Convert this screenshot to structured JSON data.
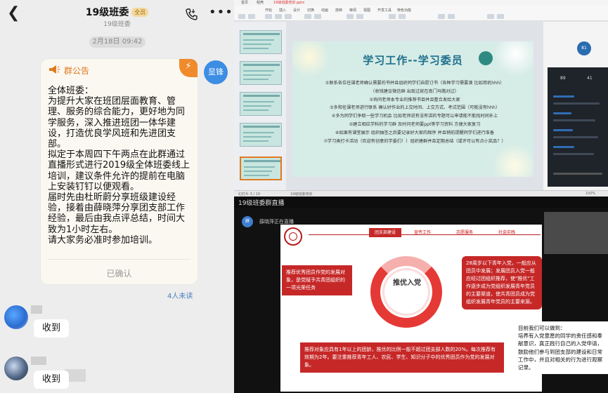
{
  "chat": {
    "header": {
      "title": "19级班委",
      "badge": "全员",
      "subtitle": "19级班委"
    },
    "date_divider": "2月18日 09:42",
    "notice": {
      "label": "群公告",
      "body": "全体班委：\n为提升大家在班团层面教育、管理、服务的综合能力，更好地为同学服务，深入推进班团一体华建设，打造优良学风班和先进团支部。\n拟定于本周四下午两点在此群通过直播形式进行2019级全体班委线上培训，建议条件允许的提前在电脑上安装钉钉以便观看。\n届时先由杜昕蔚分享班级建设经验，接着由薛晓萍分享团支部工作经验，最后由我点评总结，时间大致为1小时左右。\n请大家务必准时参加培训。",
      "confirmed": "已确认",
      "sender_name": "显锋"
    },
    "unread": "4人未读",
    "messages": [
      {
        "text": "收到"
      },
      {
        "text": "收到"
      }
    ]
  },
  "ppt": {
    "tabs": [
      "首页",
      "稻壳",
      "19级班委培训.pptx"
    ],
    "ribbon_tabs": [
      "开始",
      "插入",
      "设计",
      "切换",
      "动画",
      "放映",
      "审阅",
      "视图",
      "开发工具",
      "特色功能"
    ],
    "slide": {
      "title": "学习工作--学习委员",
      "lines": [
        "①联系各位任课老师确认需要的书并且组织同学们自愿订书（各种学习需要滴 比如耳机hhh）",
        "（收钱建议微信群 出现过就在南门马路对过）",
        "②询问老师本专业的推荐书目并且整合发给大家",
        "③多和任课老师进行联系 确认好作业的上交时间、上交方式、考试范围（可能没有hhh）",
        "④多为同学们争取一些学习机会 比如老师说有没有讲的专题可以申请能不能找时间补上",
        "⑤建立相应学科的学习群 及时问老师要ppt等学习资料 方便大家复习",
        "⑥如果有课堂展示 组织抽签之后要记录好大家的顺序 并且稍前提醒同学们进行准备",
        "⑦学习类打卡活动（欢迎有创意的学委们！）组织建群并且定期总结（或许可以有点小奖品？）"
      ]
    },
    "side": {
      "avatar": "81",
      "stats": [
        "89",
        "41"
      ]
    },
    "status": [
      "幻灯片 3 / 10",
      "19级班委培训",
      "100%"
    ]
  },
  "stream": {
    "title": "19级班委群直播",
    "presenter_avatar": "薛",
    "presenter": "薛晓萍正在直播",
    "nav": [
      "团支部建设",
      "宣传工作",
      "志愿服务",
      "社会实践"
    ],
    "center": "推优入党",
    "left_box": "推荐优秀团员作党的发展对象，是党赋予共青团组织的一项光荣任务",
    "right_box": "28周岁以下青年入党，一般应从团员中发展；发展团员入党一般应经过团组织推荐，使\"推优\"工作逐步成为党组织发展青年党员的主要渠道，使共青团员成为党组织发展青年党员的主要来源。",
    "bottom_box": "推荐对象应具有1年以上的团龄，推优的比例一般不超过团支部人数的20%。每次推荐有效期为2年。要注重推荐青年工人、农民、学生、知识分子中的优秀团员作为党的发展对象。",
    "right_text": "目前我们可以做到：\n培养有入党意愿的同学的责任感和奉献意识，真正践行自己的入党申请，鼓励他们参与到团支部的建设和日常工作中，并且对相关的行为进行观察记录。"
  },
  "colors": {
    "accent": "#3c8de3",
    "notice_orange": "#f08a2b",
    "party_red": "#c62828"
  }
}
